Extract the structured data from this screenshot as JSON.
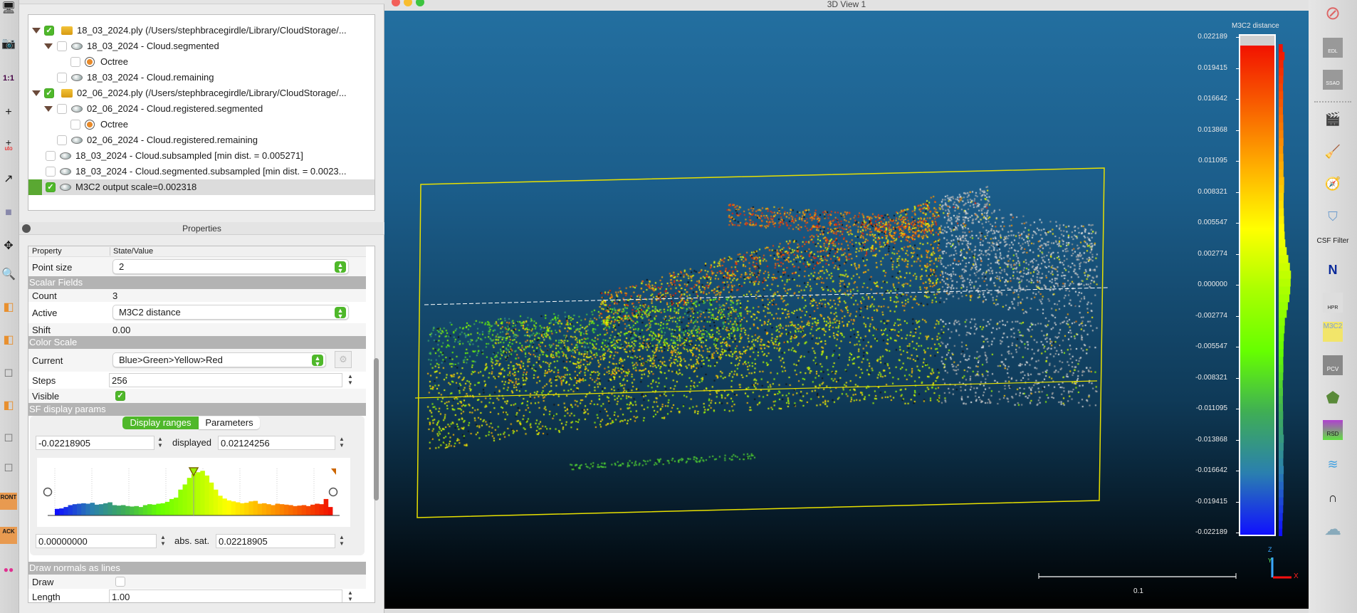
{
  "view": {
    "title": "3D View 1",
    "scale_bar_label": "0.1",
    "axis_labels": {
      "z": "Z",
      "y": "Y",
      "x": "X"
    },
    "color_bar": {
      "title": "M3C2 distance",
      "ticks": [
        "0.022189",
        "0.019415",
        "0.016642",
        "0.013868",
        "0.011095",
        "0.008321",
        "0.005547",
        "0.002774",
        "0.000000",
        "-0.002774",
        "-0.005547",
        "-0.008321",
        "-0.011095",
        "-0.013868",
        "-0.016642",
        "-0.019415",
        "-0.022189"
      ],
      "colors": [
        "#1010ff",
        "#2a7fb0",
        "#3fae55",
        "#66ff00",
        "#aaff00",
        "#ffff00",
        "#ffb000",
        "#f86000",
        "#f21200"
      ]
    }
  },
  "db_tree": {
    "title": "DB Tree",
    "items": [
      {
        "label": "18_03_2024.ply (/Users/stephbracegirdle/Library/CloudStorage/...",
        "checked": true,
        "icon": "folder-icon"
      },
      {
        "label": "18_03_2024 - Cloud.segmented",
        "checked": false,
        "icon": "cloud-icon"
      },
      {
        "label": "Octree",
        "checked": false,
        "icon": "octree-icon"
      },
      {
        "label": "18_03_2024 - Cloud.remaining",
        "checked": false,
        "icon": "cloud-icon"
      },
      {
        "label": "02_06_2024.ply (/Users/stephbracegirdle/Library/CloudStorage/...",
        "checked": true,
        "icon": "folder-icon"
      },
      {
        "label": "02_06_2024 - Cloud.registered.segmented",
        "checked": false,
        "icon": "cloud-icon"
      },
      {
        "label": "Octree",
        "checked": false,
        "icon": "octree-icon"
      },
      {
        "label": "02_06_2024 - Cloud.registered.remaining",
        "checked": false,
        "icon": "cloud-icon"
      },
      {
        "label": "18_03_2024 - Cloud.subsampled [min dist. = 0.005271]",
        "checked": false,
        "icon": "cloud-icon"
      },
      {
        "label": "18_03_2024 - Cloud.segmented.subsampled [min dist. = 0.0023...",
        "checked": false,
        "icon": "cloud-icon"
      },
      {
        "label": "M3C2 output scale=0.002318",
        "checked": true,
        "icon": "cloud-icon",
        "selected": true
      }
    ]
  },
  "properties": {
    "title": "Properties",
    "col_property": "Property",
    "col_value": "State/Value",
    "point_size_label": "Point size",
    "point_size": "2",
    "scalar_fields_section": "Scalar Fields",
    "count_label": "Count",
    "count": "3",
    "active_label": "Active",
    "active": "M3C2 distance",
    "shift_label": "Shift",
    "shift": "0.00",
    "color_scale_section": "Color Scale",
    "current_label": "Current",
    "current": "Blue>Green>Yellow>Red",
    "steps_label": "Steps",
    "steps": "256",
    "visible_label": "Visible",
    "visible": true,
    "sf_display_section": "SF display params",
    "tab_display_ranges": "Display ranges",
    "tab_parameters": "Parameters",
    "display_min": "-0.02218905",
    "displayed_label": "displayed",
    "display_max": "0.02124256",
    "sat_min": "0.00000000",
    "abs_sat_label": "abs. sat.",
    "sat_max": "0.02218905",
    "histogram": [
      14,
      15,
      18,
      22,
      24,
      25,
      26,
      25,
      27,
      23,
      24,
      26,
      28,
      22,
      21,
      22,
      20,
      19,
      20,
      18,
      22,
      24,
      23,
      25,
      26,
      29,
      35,
      38,
      55,
      66,
      80,
      88,
      92,
      95,
      85,
      70,
      55,
      42,
      36,
      32,
      30,
      28,
      26,
      27,
      30,
      31,
      25,
      26,
      24,
      22,
      25,
      24,
      23,
      22,
      20,
      21,
      22,
      20,
      23,
      25,
      24,
      35,
      18
    ],
    "normals_section": "Draw normals as lines",
    "draw_label": "Draw",
    "draw": false,
    "length_label": "Length",
    "length": "1.00"
  },
  "left_toolbar": {
    "one_to_one": "1:1",
    "auto": "uto",
    "front": "RONT",
    "back": "ACK"
  },
  "right_toolbar": {
    "edl": "EDL",
    "ssao": "SSAO",
    "csf_filter": "CSF Filter",
    "m3c2": "M3C2",
    "pcv": "PCV",
    "rsd": "RSD",
    "hpr": "HPR"
  }
}
